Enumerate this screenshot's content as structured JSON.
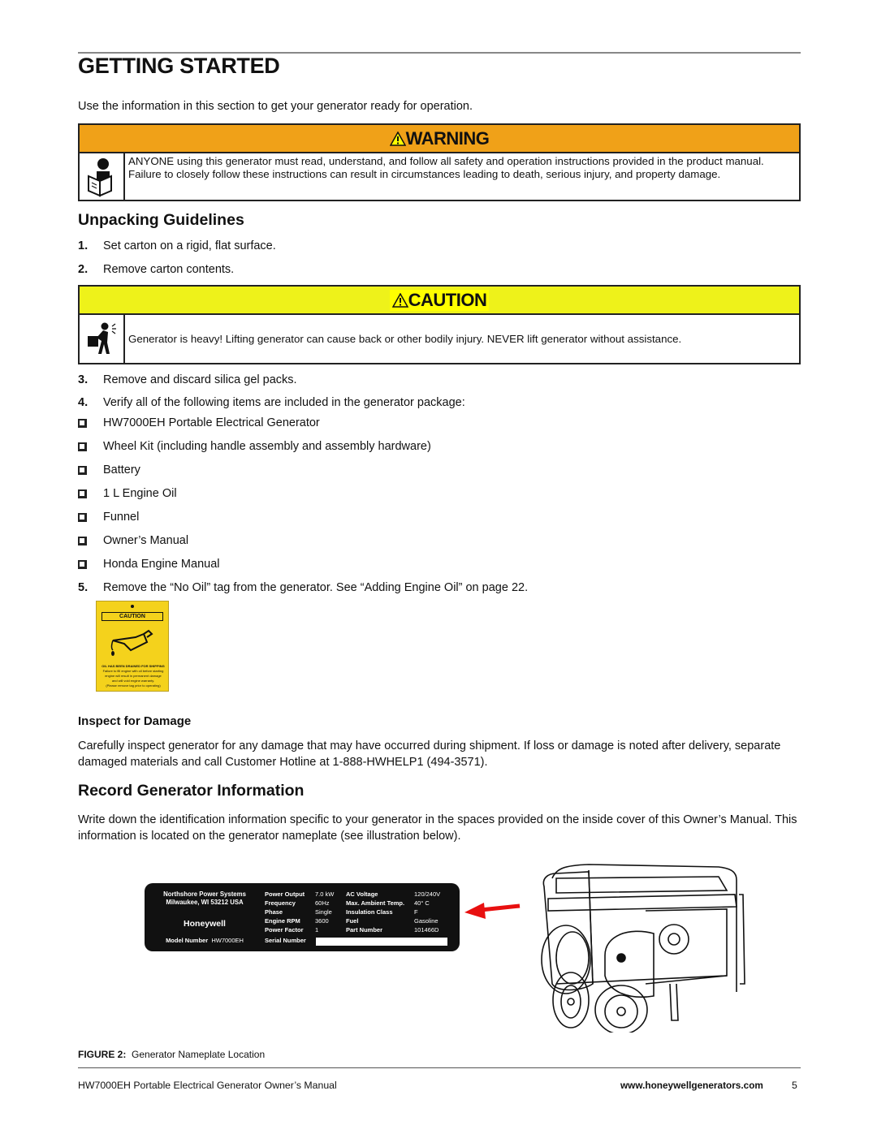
{
  "page": {
    "title": "GETTING STARTED",
    "intro": "Use the information in this section to get your generator ready for operation."
  },
  "warning": {
    "label": "WARNING",
    "icon": "read-manual-icon",
    "text": "ANYONE using this generator must read, understand, and follow all safety and operation instructions provided in the product manual. Failure to closely follow these instructions can result in circumstances leading to death, serious injury, and property damage.",
    "color": "#f0a118"
  },
  "unpacking": {
    "heading": "Unpacking Guidelines",
    "steps_before": [
      {
        "num": "1.",
        "text": "Set carton on a rigid, flat surface."
      },
      {
        "num": "2.",
        "text": "Remove carton contents."
      }
    ],
    "steps_after": [
      {
        "num": "3.",
        "text": "Remove and discard silica gel packs."
      },
      {
        "num": "4.",
        "text": "Verify all of the following items are included in the generator package:"
      }
    ],
    "checklist": [
      "HW7000EH Portable Electrical Generator",
      "Wheel Kit (including handle assembly and assembly hardware)",
      "Battery",
      "1 L Engine Oil",
      "Funnel",
      "Owner’s Manual",
      "Honda Engine Manual"
    ],
    "step5": {
      "num": "5.",
      "text": "Remove the “No Oil” tag from the generator. See “Adding Engine Oil” on page 22."
    }
  },
  "caution": {
    "label": "CAUTION",
    "icon": "heavy-lifting-icon",
    "text": "Generator is heavy! Lifting generator can cause back or other bodily injury. NEVER lift generator without assistance.",
    "color": "#eef21a"
  },
  "oil_tag": {
    "label": "CAUTION",
    "line1": "OIL HAS BEEN DRAINED FOR SHIPPING",
    "line2": "Failure to fill engine with oil before starting",
    "line3": "engine will result in permanent damage",
    "line4": "and will void engine warranty.",
    "line5": "(Please remove tag prior to operating)"
  },
  "inspect": {
    "heading": "Inspect for Damage",
    "text": "Carefully inspect generator for any damage that may have occurred during shipment. If loss or damage is noted after delivery, separate damaged materials and call Customer Hotline at 1-888-HWHELP1 (494-3571)."
  },
  "record": {
    "heading": "Record Generator Information",
    "text": "Write down the identification information specific to your generator in the spaces provided on the inside cover of this Owner’s Manual. This information is located on the generator nameplate (see illustration below)."
  },
  "nameplate": {
    "company": "Northshore Power Systems",
    "address": "Milwaukee, WI 53212 USA",
    "brand": "Honeywell",
    "model_label": "Model Number",
    "model_value": "HW7000EH",
    "specs_left": [
      {
        "k": "Power Output",
        "v": "7.0 kW"
      },
      {
        "k": "Frequency",
        "v": "60Hz"
      },
      {
        "k": "Phase",
        "v": "Single"
      },
      {
        "k": "Engine RPM",
        "v": "3600"
      },
      {
        "k": "Power Factor",
        "v": "1"
      }
    ],
    "specs_right": [
      {
        "k": "AC Voltage",
        "v": "120/240V"
      },
      {
        "k": "Max. Ambient Temp.",
        "v": "40° C"
      },
      {
        "k": "Insulation Class",
        "v": "F"
      },
      {
        "k": "Fuel",
        "v": "Gasoline"
      },
      {
        "k": "Part Number",
        "v": "101466D"
      }
    ],
    "serial_label": "Serial Number",
    "arrow_color": "#e81010"
  },
  "figure": {
    "label": "FIGURE 2:",
    "caption": "Generator Nameplate Location"
  },
  "footer": {
    "manual": "HW7000EH Portable Electrical Generator Owner’s Manual",
    "url": "www.honeywellgenerators.com",
    "page": "5"
  }
}
